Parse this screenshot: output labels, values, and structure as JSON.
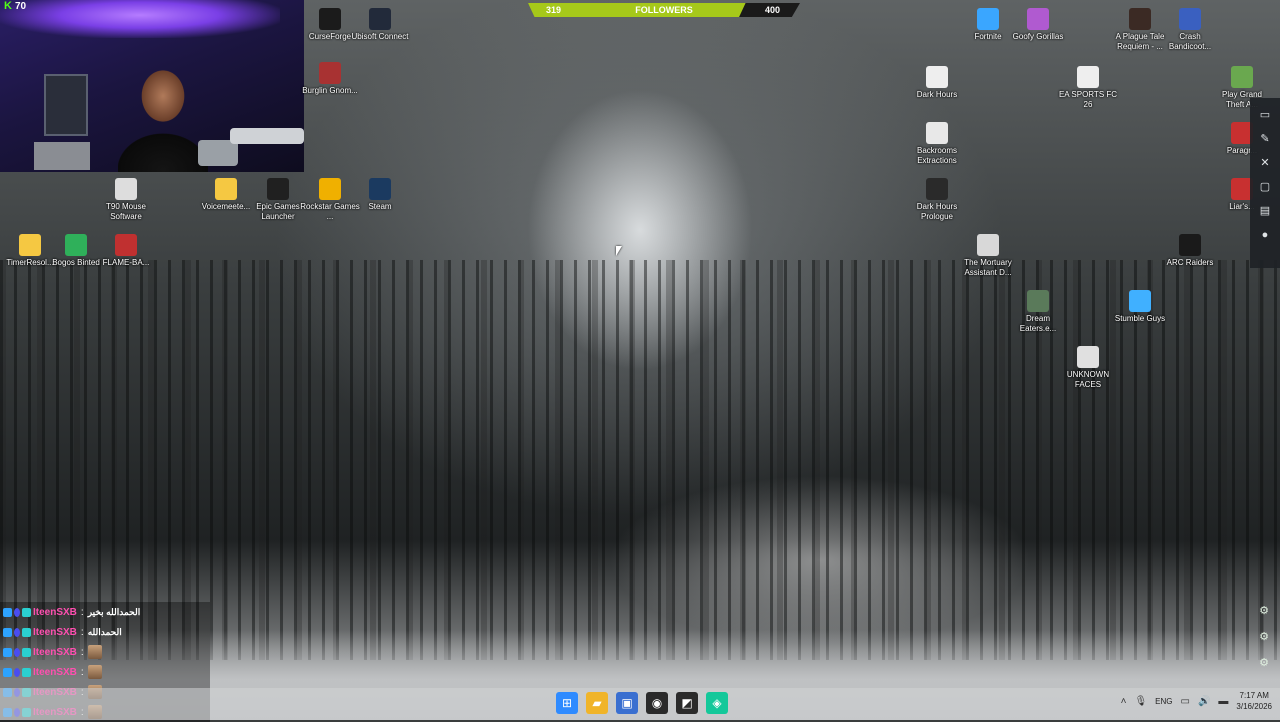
{
  "overlay": {
    "viewer_count": "70",
    "followers": {
      "current": "319",
      "label": "FOLLOWERS",
      "goal": "400",
      "progress_fraction": 0.8
    }
  },
  "desktop": {
    "icons": [
      {
        "label": "CurseForge",
        "icon": "curseforge-icon",
        "color": "#1b1b1b"
      },
      {
        "label": "Ubisoft Connect",
        "icon": "ubisoft-icon",
        "color": "#222a3a"
      },
      {
        "label": "Burglin Gnom...",
        "icon": "game-icon",
        "color": "#a83232"
      },
      {
        "label": "Fortnite",
        "icon": "fortnite-icon",
        "color": "#3aa6ff"
      },
      {
        "label": "Goofy Gorillas",
        "icon": "game-icon",
        "color": "#b05ad0"
      },
      {
        "label": "A Plague Tale Requiem - ...",
        "icon": "game-icon",
        "color": "#3b2a24"
      },
      {
        "label": "Crash Bandicoot...",
        "icon": "game-icon",
        "color": "#3a60c0"
      },
      {
        "label": "Dark Hours",
        "icon": "game-icon",
        "color": "#eeeeee"
      },
      {
        "label": "EA SPORTS FC 26",
        "icon": "game-icon",
        "color": "#eeeeee"
      },
      {
        "label": "Play Grand Theft A...",
        "icon": "gta-icon",
        "color": "#6aa84f"
      },
      {
        "label": "Backrooms Extractions",
        "icon": "game-icon",
        "color": "#e8e8e8"
      },
      {
        "label": "Paragr...",
        "icon": "game-icon",
        "color": "#c83030"
      },
      {
        "label": "Dark Hours Prologue",
        "icon": "game-icon",
        "color": "#2a2a2a"
      },
      {
        "label": "Liar's...",
        "icon": "game-icon",
        "color": "#c83030"
      },
      {
        "label": "T90 Mouse Software",
        "icon": "app-icon",
        "color": "#dddddd"
      },
      {
        "label": "Voicemeete...",
        "icon": "folder-icon",
        "color": "#f5c842"
      },
      {
        "label": "Epic Games Launcher",
        "icon": "epic-icon",
        "color": "#202020"
      },
      {
        "label": "Rockstar Games ...",
        "icon": "rockstar-icon",
        "color": "#f0b000"
      },
      {
        "label": "Steam",
        "icon": "steam-icon",
        "color": "#1b3a60"
      },
      {
        "label": "TimerResol...",
        "icon": "folder-icon",
        "color": "#f5c842"
      },
      {
        "label": "Bogos Binted",
        "icon": "game-icon",
        "color": "#2fb05a"
      },
      {
        "label": "FLAME-BA...",
        "icon": "game-icon",
        "color": "#c03030"
      },
      {
        "label": "The Mortuary Assistant D...",
        "icon": "game-icon",
        "color": "#d8d8d8"
      },
      {
        "label": "ARC Raiders",
        "icon": "game-icon",
        "color": "#1a1a1a"
      },
      {
        "label": "Dream Eaters.e...",
        "icon": "game-icon",
        "color": "#5a7a5a"
      },
      {
        "label": "Stumble Guys",
        "icon": "game-icon",
        "color": "#40b0ff"
      },
      {
        "label": "UNKNOWN FACES",
        "icon": "game-icon",
        "color": "#e0e0e0"
      }
    ]
  },
  "chat": {
    "messages": [
      {
        "user": "IteenSXB",
        "text": "الحمدالله بخير"
      },
      {
        "user": "IteenSXB",
        "text": "الحمدالله"
      },
      {
        "user": "IteenSXB",
        "text": "",
        "emote": true
      },
      {
        "user": "IteenSXB",
        "text": "",
        "emote": true
      },
      {
        "user": "IteenSXB",
        "text": "",
        "emote": true
      },
      {
        "user": "IteenSXB",
        "text": "",
        "emote": true
      }
    ]
  },
  "taskbar": {
    "pinned": [
      {
        "name": "start-icon",
        "color": "#2f8bff"
      },
      {
        "name": "file-explorer-icon",
        "color": "#f0b429"
      },
      {
        "name": "store-icon",
        "color": "#3a6fd0"
      },
      {
        "name": "obs-icon",
        "color": "#2a2a2a"
      },
      {
        "name": "nvidia-icon",
        "color": "#2b2b2b"
      },
      {
        "name": "app-icon",
        "color": "#14c89a"
      }
    ],
    "tray": {
      "language": "ENG",
      "time": "7:17 AM",
      "date": "3/16/2026"
    }
  }
}
